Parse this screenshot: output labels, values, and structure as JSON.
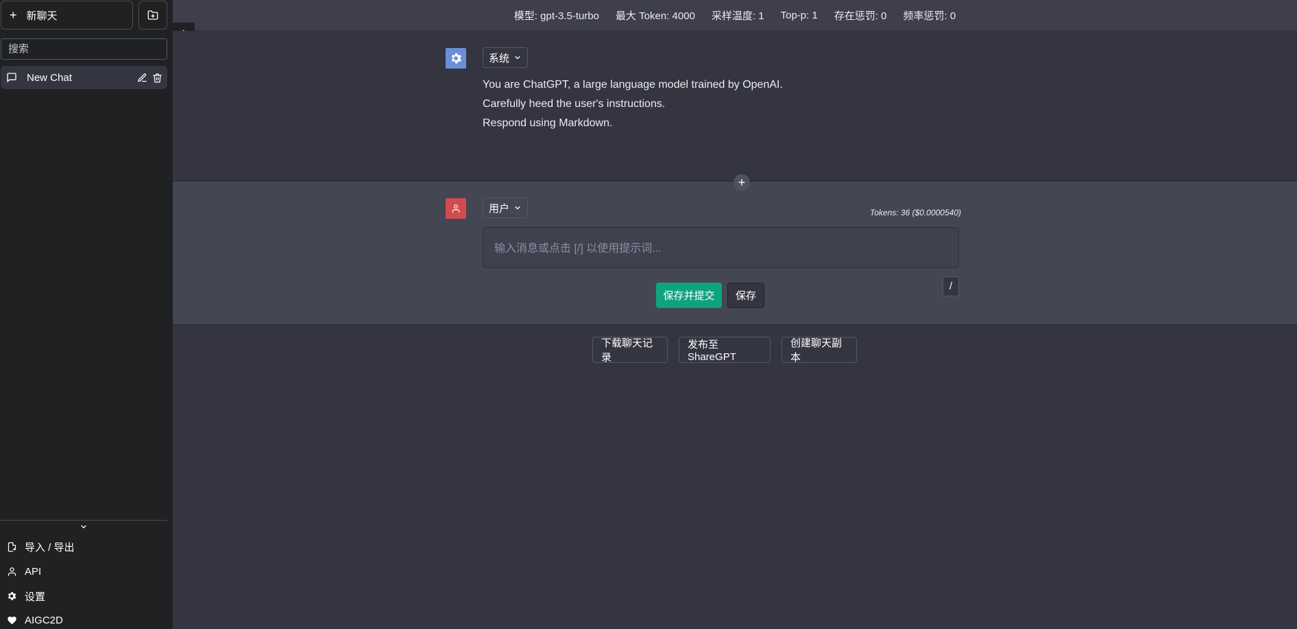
{
  "sidebar": {
    "new_chat_label": "新聊天",
    "search_placeholder": "搜索",
    "chats": [
      {
        "label": "New Chat"
      }
    ],
    "menu": [
      {
        "label": "导入 / 导出",
        "icon": "import-export-icon"
      },
      {
        "label": "API",
        "icon": "person-icon"
      },
      {
        "label": "设置",
        "icon": "gear-icon"
      },
      {
        "label": "AIGC2D",
        "icon": "heart-icon"
      }
    ]
  },
  "topbar": {
    "items": [
      "模型: gpt-3.5-turbo",
      "最大 Token: 4000",
      "采样温度: 1",
      "Top-p: 1",
      "存在惩罚: 0",
      "频率惩罚: 0"
    ]
  },
  "system_message": {
    "role": "系统",
    "lines": [
      "You are ChatGPT, a large language model trained by OpenAI.",
      "Carefully heed the user's instructions.",
      "Respond using Markdown."
    ],
    "avatar_color": "#6b8fd6"
  },
  "user_message": {
    "role": "用户",
    "tokens": "Tokens: 36 ($0.0000540)",
    "placeholder": "输入消息或点击 [/] 以使用提示词...",
    "value": "",
    "submit_label": "保存并提交",
    "save_label": "保存",
    "slash_label": "/",
    "avatar_color": "#d24b4e"
  },
  "actions": {
    "download": "下载聊天记录",
    "share": "发布至 ShareGPT",
    "clone": "创建聊天副本"
  },
  "colors": {
    "accent": "#10a37f",
    "sidebar_bg": "#202123",
    "main_bg": "#343541"
  }
}
